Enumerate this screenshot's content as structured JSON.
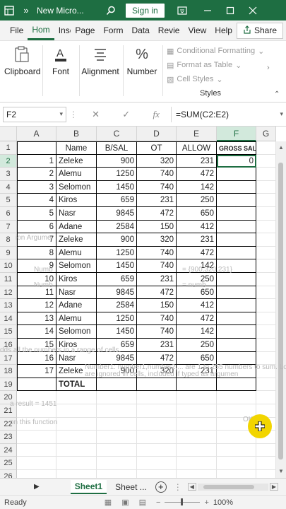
{
  "titlebar": {
    "title": "New Micro...",
    "signin": "Sign in",
    "more": "»"
  },
  "tabs": [
    "File",
    "Hom",
    "Insert",
    "Page",
    "Form",
    "Data",
    "Revie",
    "View",
    "Help"
  ],
  "share": "Share",
  "ribbon": {
    "clipboard": "Clipboard",
    "font": "Font",
    "alignment": "Alignment",
    "number": "Number",
    "conditional": "Conditional Formatting",
    "format_table": "Format as Table",
    "cell_styles": "Cell Styles",
    "styles": "Styles"
  },
  "formula_bar": {
    "name_box": "F2",
    "formula": "=SUM(C2:E2)",
    "fx": "fx"
  },
  "columns": [
    "A",
    "B",
    "C",
    "D",
    "E",
    "F",
    "G"
  ],
  "rows": [
    "1",
    "2",
    "3",
    "4",
    "5",
    "6",
    "7",
    "8",
    "9",
    "10",
    "11",
    "12",
    "13",
    "14",
    "15",
    "16",
    "17",
    "18",
    "19",
    "20",
    "21",
    "22",
    "23",
    "24",
    "25",
    "26"
  ],
  "headers": {
    "B": "Name",
    "C": "B/SAL",
    "D": "OT",
    "E": "ALLOW",
    "F": "GROSS SAL"
  },
  "data": [
    {
      "n": "1",
      "name": "Zeleke",
      "bsal": "900",
      "ot": "320",
      "allow": "231",
      "gross": "0"
    },
    {
      "n": "2",
      "name": "Alemu",
      "bsal": "1250",
      "ot": "740",
      "allow": "472",
      "gross": ""
    },
    {
      "n": "3",
      "name": "Selomon",
      "bsal": "1450",
      "ot": "740",
      "allow": "142",
      "gross": ""
    },
    {
      "n": "4",
      "name": "Kiros",
      "bsal": "659",
      "ot": "231",
      "allow": "250",
      "gross": ""
    },
    {
      "n": "5",
      "name": "Nasr",
      "bsal": "9845",
      "ot": "472",
      "allow": "650",
      "gross": ""
    },
    {
      "n": "6",
      "name": "Adane",
      "bsal": "2584",
      "ot": "150",
      "allow": "412",
      "gross": ""
    },
    {
      "n": "7",
      "name": "Zeleke",
      "bsal": "900",
      "ot": "320",
      "allow": "231",
      "gross": ""
    },
    {
      "n": "8",
      "name": "Alemu",
      "bsal": "1250",
      "ot": "740",
      "allow": "472",
      "gross": ""
    },
    {
      "n": "9",
      "name": "Selomon",
      "bsal": "1450",
      "ot": "740",
      "allow": "142",
      "gross": ""
    },
    {
      "n": "10",
      "name": "Kiros",
      "bsal": "659",
      "ot": "231",
      "allow": "250",
      "gross": ""
    },
    {
      "n": "11",
      "name": "Nasr",
      "bsal": "9845",
      "ot": "472",
      "allow": "650",
      "gross": ""
    },
    {
      "n": "12",
      "name": "Adane",
      "bsal": "2584",
      "ot": "150",
      "allow": "412",
      "gross": ""
    },
    {
      "n": "13",
      "name": "Alemu",
      "bsal": "1250",
      "ot": "740",
      "allow": "472",
      "gross": ""
    },
    {
      "n": "14",
      "name": "Selomon",
      "bsal": "1450",
      "ot": "740",
      "allow": "142",
      "gross": ""
    },
    {
      "n": "15",
      "name": "Kiros",
      "bsal": "659",
      "ot": "231",
      "allow": "250",
      "gross": ""
    },
    {
      "n": "16",
      "name": "Nasr",
      "bsal": "9845",
      "ot": "472",
      "allow": "650",
      "gross": ""
    },
    {
      "n": "17",
      "name": "Zeleke",
      "bsal": "900",
      "ot": "320",
      "allow": "231",
      "gross": ""
    }
  ],
  "total_label": "TOTAL",
  "ghost": {
    "g1": "ion Argume",
    "g2": "Numb",
    "g3": "= {900,320,231}",
    "g4": "Numb",
    "g5": "= numb",
    "g6": "dds all the numbers in a range of cells.",
    "g7": "Number1: number1,number2,... are 1 to 255 numbers to sum. Lo",
    "g8": "are ignored in cells, included if typed as argumen",
    "g9": "a result =   1451",
    "g10": "on this function",
    "g11": "OK"
  },
  "sheets": {
    "active": "Sheet1",
    "other": "Sheet ...",
    "add": "+"
  },
  "status": {
    "ready": "Ready",
    "zoom": "100%"
  }
}
